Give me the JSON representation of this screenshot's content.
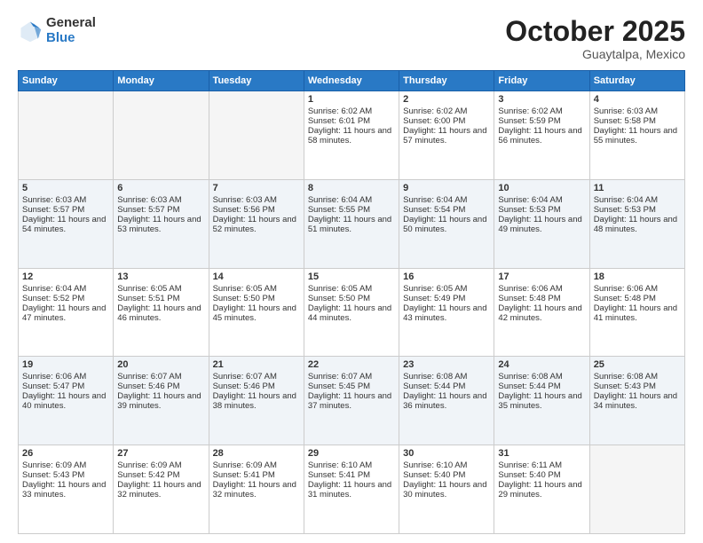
{
  "header": {
    "logo_general": "General",
    "logo_blue": "Blue",
    "month": "October 2025",
    "location": "Guaytalpa, Mexico"
  },
  "days_of_week": [
    "Sunday",
    "Monday",
    "Tuesday",
    "Wednesday",
    "Thursday",
    "Friday",
    "Saturday"
  ],
  "weeks": [
    [
      {
        "day": "",
        "info": ""
      },
      {
        "day": "",
        "info": ""
      },
      {
        "day": "",
        "info": ""
      },
      {
        "day": "1",
        "sunrise": "Sunrise: 6:02 AM",
        "sunset": "Sunset: 6:01 PM",
        "daylight": "Daylight: 11 hours and 58 minutes."
      },
      {
        "day": "2",
        "sunrise": "Sunrise: 6:02 AM",
        "sunset": "Sunset: 6:00 PM",
        "daylight": "Daylight: 11 hours and 57 minutes."
      },
      {
        "day": "3",
        "sunrise": "Sunrise: 6:02 AM",
        "sunset": "Sunset: 5:59 PM",
        "daylight": "Daylight: 11 hours and 56 minutes."
      },
      {
        "day": "4",
        "sunrise": "Sunrise: 6:03 AM",
        "sunset": "Sunset: 5:58 PM",
        "daylight": "Daylight: 11 hours and 55 minutes."
      }
    ],
    [
      {
        "day": "5",
        "sunrise": "Sunrise: 6:03 AM",
        "sunset": "Sunset: 5:57 PM",
        "daylight": "Daylight: 11 hours and 54 minutes."
      },
      {
        "day": "6",
        "sunrise": "Sunrise: 6:03 AM",
        "sunset": "Sunset: 5:57 PM",
        "daylight": "Daylight: 11 hours and 53 minutes."
      },
      {
        "day": "7",
        "sunrise": "Sunrise: 6:03 AM",
        "sunset": "Sunset: 5:56 PM",
        "daylight": "Daylight: 11 hours and 52 minutes."
      },
      {
        "day": "8",
        "sunrise": "Sunrise: 6:04 AM",
        "sunset": "Sunset: 5:55 PM",
        "daylight": "Daylight: 11 hours and 51 minutes."
      },
      {
        "day": "9",
        "sunrise": "Sunrise: 6:04 AM",
        "sunset": "Sunset: 5:54 PM",
        "daylight": "Daylight: 11 hours and 50 minutes."
      },
      {
        "day": "10",
        "sunrise": "Sunrise: 6:04 AM",
        "sunset": "Sunset: 5:53 PM",
        "daylight": "Daylight: 11 hours and 49 minutes."
      },
      {
        "day": "11",
        "sunrise": "Sunrise: 6:04 AM",
        "sunset": "Sunset: 5:53 PM",
        "daylight": "Daylight: 11 hours and 48 minutes."
      }
    ],
    [
      {
        "day": "12",
        "sunrise": "Sunrise: 6:04 AM",
        "sunset": "Sunset: 5:52 PM",
        "daylight": "Daylight: 11 hours and 47 minutes."
      },
      {
        "day": "13",
        "sunrise": "Sunrise: 6:05 AM",
        "sunset": "Sunset: 5:51 PM",
        "daylight": "Daylight: 11 hours and 46 minutes."
      },
      {
        "day": "14",
        "sunrise": "Sunrise: 6:05 AM",
        "sunset": "Sunset: 5:50 PM",
        "daylight": "Daylight: 11 hours and 45 minutes."
      },
      {
        "day": "15",
        "sunrise": "Sunrise: 6:05 AM",
        "sunset": "Sunset: 5:50 PM",
        "daylight": "Daylight: 11 hours and 44 minutes."
      },
      {
        "day": "16",
        "sunrise": "Sunrise: 6:05 AM",
        "sunset": "Sunset: 5:49 PM",
        "daylight": "Daylight: 11 hours and 43 minutes."
      },
      {
        "day": "17",
        "sunrise": "Sunrise: 6:06 AM",
        "sunset": "Sunset: 5:48 PM",
        "daylight": "Daylight: 11 hours and 42 minutes."
      },
      {
        "day": "18",
        "sunrise": "Sunrise: 6:06 AM",
        "sunset": "Sunset: 5:48 PM",
        "daylight": "Daylight: 11 hours and 41 minutes."
      }
    ],
    [
      {
        "day": "19",
        "sunrise": "Sunrise: 6:06 AM",
        "sunset": "Sunset: 5:47 PM",
        "daylight": "Daylight: 11 hours and 40 minutes."
      },
      {
        "day": "20",
        "sunrise": "Sunrise: 6:07 AM",
        "sunset": "Sunset: 5:46 PM",
        "daylight": "Daylight: 11 hours and 39 minutes."
      },
      {
        "day": "21",
        "sunrise": "Sunrise: 6:07 AM",
        "sunset": "Sunset: 5:46 PM",
        "daylight": "Daylight: 11 hours and 38 minutes."
      },
      {
        "day": "22",
        "sunrise": "Sunrise: 6:07 AM",
        "sunset": "Sunset: 5:45 PM",
        "daylight": "Daylight: 11 hours and 37 minutes."
      },
      {
        "day": "23",
        "sunrise": "Sunrise: 6:08 AM",
        "sunset": "Sunset: 5:44 PM",
        "daylight": "Daylight: 11 hours and 36 minutes."
      },
      {
        "day": "24",
        "sunrise": "Sunrise: 6:08 AM",
        "sunset": "Sunset: 5:44 PM",
        "daylight": "Daylight: 11 hours and 35 minutes."
      },
      {
        "day": "25",
        "sunrise": "Sunrise: 6:08 AM",
        "sunset": "Sunset: 5:43 PM",
        "daylight": "Daylight: 11 hours and 34 minutes."
      }
    ],
    [
      {
        "day": "26",
        "sunrise": "Sunrise: 6:09 AM",
        "sunset": "Sunset: 5:43 PM",
        "daylight": "Daylight: 11 hours and 33 minutes."
      },
      {
        "day": "27",
        "sunrise": "Sunrise: 6:09 AM",
        "sunset": "Sunset: 5:42 PM",
        "daylight": "Daylight: 11 hours and 32 minutes."
      },
      {
        "day": "28",
        "sunrise": "Sunrise: 6:09 AM",
        "sunset": "Sunset: 5:41 PM",
        "daylight": "Daylight: 11 hours and 32 minutes."
      },
      {
        "day": "29",
        "sunrise": "Sunrise: 6:10 AM",
        "sunset": "Sunset: 5:41 PM",
        "daylight": "Daylight: 11 hours and 31 minutes."
      },
      {
        "day": "30",
        "sunrise": "Sunrise: 6:10 AM",
        "sunset": "Sunset: 5:40 PM",
        "daylight": "Daylight: 11 hours and 30 minutes."
      },
      {
        "day": "31",
        "sunrise": "Sunrise: 6:11 AM",
        "sunset": "Sunset: 5:40 PM",
        "daylight": "Daylight: 11 hours and 29 minutes."
      },
      {
        "day": "",
        "info": ""
      }
    ]
  ]
}
